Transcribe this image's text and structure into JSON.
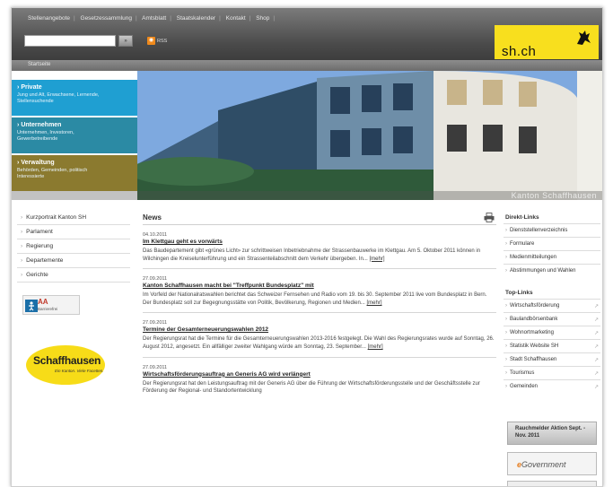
{
  "header": {
    "topnav": [
      "Stellenangebote",
      "Gesetzessammlung",
      "Amtsblatt",
      "Staatskalender",
      "Kontakt",
      "Shop"
    ],
    "search_placeholder": "",
    "search_button": "»",
    "rss_label": "RSS",
    "logo": "sh.ch"
  },
  "breadcrumb": "Startseite",
  "hero": {
    "caption": "Kanton Schaffhausen",
    "tabs": [
      {
        "title": "Private",
        "subtitle": "Jung und Alt, Erwachsene, Lernende, Stellensuchende",
        "color": "#1f9fd2"
      },
      {
        "title": "Unternehmen",
        "subtitle": "Unternehmen, Investoren, Gewerbetreibende",
        "color": "#2b8aa4"
      },
      {
        "title": "Verwaltung",
        "subtitle": "Behörden, Gemeinden, politisch Interessierte",
        "color": "#8b7a2f"
      }
    ]
  },
  "leftnav": {
    "items": [
      "Kurzportrait Kanton SH",
      "Parlament",
      "Regierung",
      "Departemente",
      "Gerichte"
    ],
    "badge_title": "AA",
    "badge_sub": "Barrierefrei",
    "sh_logo_main": "Schaffhausen",
    "sh_logo_sub": "Ein Kanton. Viele Facetten."
  },
  "main": {
    "title": "News",
    "news": [
      {
        "date": "04.10.2011",
        "title": "Im Klettgau geht es vorwärts",
        "text": "Das Baudepartement gibt «grünes Licht» zur schrittweisen Inbetriebnahme der Strassenbauwerke im Klettgau. Am 5. Oktober 2011 können in Wilchingen die Kreiselunterführung und ein Strassenteilabschnitt dem Verkehr übergeben. In...",
        "more": "[mehr]"
      },
      {
        "date": "27.09.2011",
        "title": "Kanton Schaffhausen macht bei \"Treffpunkt Bundesplatz\" mit",
        "text": "Im Vorfeld der Nationalratswahlen berichtet das Schweizer Fernsehen und Radio vom 19. bis 30. September 2011 live vom Bundesplatz in Bern. Der Bundesplatz soll zur Begegnungsstätte von Politik, Bevölkerung, Regionen und Medien...",
        "more": "[mehr]"
      },
      {
        "date": "27.09.2011",
        "title": "Termine der Gesamterneuerungswahlen 2012",
        "text": "Der Regierungsrat hat die Termine für die Gesamterneuerungswahlen 2013-2016 festgelegt. Die Wahl des Regierungsrates wurde auf Sonntag, 26. August 2012, angesetzt. Ein allfälliger zweiter Wahlgang würde am Sonntag, 23. September...",
        "more": "[mehr]"
      },
      {
        "date": "27.09.2011",
        "title": "Wirtschaftsförderungsauftrag an Generis AG wird verlängert",
        "text": "Der Regierungsrat hat den Leistungsauftrag mit der Generis AG über die Führung der Wirtschaftsförderungsstelle und der Geschäftsstelle zur Förderung der Regional- und Standortentwicklung",
        "more": ""
      }
    ]
  },
  "right": {
    "direct_title": "Direkt-Links",
    "direct_links": [
      "Dienststellenverzeichnis",
      "Formulare",
      "Medienmitteilungen",
      "Abstimmungen und Wahlen"
    ],
    "top_title": "Top-Links",
    "top_links": [
      "Wirtschaftsförderung",
      "Baulandbörsenbank",
      "Wohnortmarketing",
      "Statistik Website SH",
      "Stadt Schaffhausen",
      "Tourismus",
      "Gemeinden"
    ],
    "banner1": "Rauchmelder Aktion Sept. - Nov. 2011",
    "banner2_prefix": "e",
    "banner2": "Government"
  }
}
